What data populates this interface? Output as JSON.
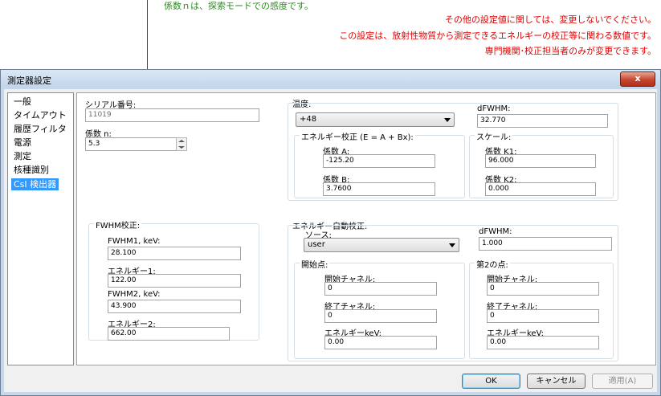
{
  "notes": {
    "green": "係数ｎは、探索モードでの感度です。",
    "red1": "その他の設定値に関しては、変更しないでください。",
    "red2": "この設定は、放射性物質から測定できるエネルギーの校正等に関わる数値です。",
    "red3": "専門機関･校正担当者のみが変更できます。"
  },
  "window": {
    "title": "測定器設定",
    "close": "x"
  },
  "nav": {
    "items": [
      "一般",
      "タイムアウト",
      "履歴フィルタ",
      "電源",
      "測定",
      "核種識別",
      "CsI 検出器"
    ],
    "selected": "CsI 検出器"
  },
  "serial": {
    "label": "シリアル番号:",
    "value": "11019"
  },
  "coef_n": {
    "label": "係数 n:",
    "value": "5.3"
  },
  "temperature": {
    "label": "温度:",
    "value": "+48"
  },
  "dfwhm1": {
    "label": "dFWHM:",
    "value": "32.770"
  },
  "energy_cal": {
    "title": "エネルギー校正 (E = A + Bx):",
    "a_label": "係数 A:",
    "a_value": "-125.20",
    "b_label": "係数 B:",
    "b_value": "3.7600"
  },
  "scale": {
    "title": "スケール:",
    "k1_label": "係数 K1:",
    "k1_value": "96.000",
    "k2_label": "係数 K2:",
    "k2_value": "0.000"
  },
  "fwhm_cal": {
    "title": "FWHM校正:",
    "fwhm1_label": "FWHM1, keV:",
    "fwhm1_value": "28.100",
    "energy1_label": "エネルギー1:",
    "energy1_value": "122.00",
    "fwhm2_label": "FWHM2, keV:",
    "fwhm2_value": "43.900",
    "energy2_label": "エネルギー2:",
    "energy2_value": "662.00"
  },
  "auto_cal": {
    "title": "エネルギー自動校正:",
    "source_label": "ソース:",
    "source_value": "user",
    "dfwhm_label": "dFWHM:",
    "dfwhm_value": "1.000",
    "start": {
      "title": "開始点:",
      "start_ch_label": "開始チャネル:",
      "start_ch_value": "0",
      "end_ch_label": "終了チャネル:",
      "end_ch_value": "0",
      "kev_label": "エネルギーkeV:",
      "kev_value": "0.00"
    },
    "second": {
      "title": "第2の点:",
      "start_ch_label": "開始チャネル:",
      "start_ch_value": "0",
      "end_ch_label": "終了チャネル:",
      "end_ch_value": "0",
      "kev_label": "エネルギーkeV:",
      "kev_value": "0.00"
    }
  },
  "buttons": {
    "ok": "OK",
    "cancel": "キャンセル",
    "apply": "適用(A)"
  }
}
